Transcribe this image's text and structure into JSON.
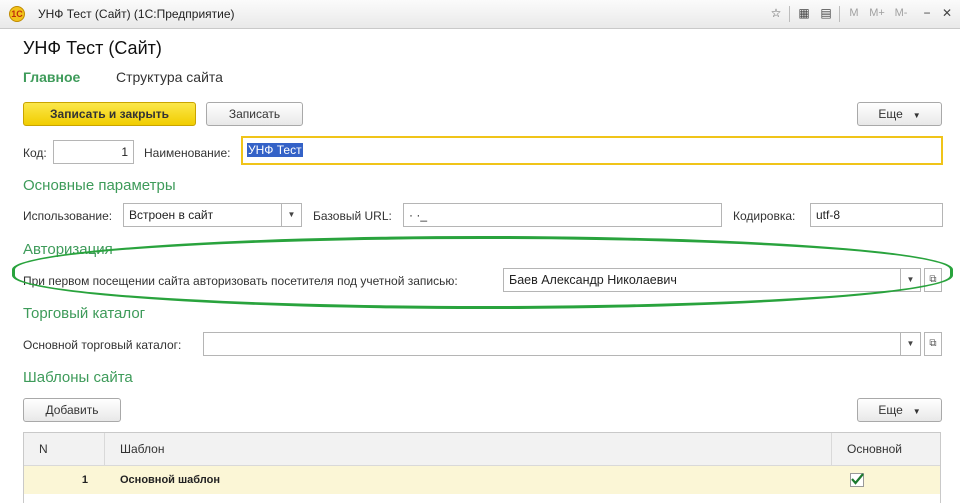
{
  "window": {
    "title": "УНФ Тест (Сайт)  (1С:Предприятие)",
    "logo_text": "1С",
    "toolbar_icons": [
      "star-icon",
      "calculator-icon",
      "calendar-icon"
    ],
    "memory_buttons": [
      "M",
      "M+",
      "M-"
    ]
  },
  "form": {
    "title": "УНФ Тест (Сайт)",
    "tabs": [
      {
        "label": "Главное",
        "active": true
      },
      {
        "label": "Структура сайта",
        "active": false
      }
    ],
    "actions": {
      "save_close": "Записать и закрыть",
      "save": "Записать",
      "more": "Еще"
    },
    "code": {
      "label": "Код:",
      "value": "1"
    },
    "name": {
      "label": "Наименование:",
      "value": "УНФ Тест"
    }
  },
  "basic": {
    "heading": "Основные параметры",
    "usage": {
      "label": "Использование:",
      "value": "Встроен в сайт"
    },
    "url": {
      "label": "Базовый URL:",
      "value": "·            ·_"
    },
    "encoding": {
      "label": "Кодировка:",
      "value": "utf-8"
    }
  },
  "auth": {
    "heading": "Авторизация",
    "label": "При первом посещении сайта авторизовать посетителя под учетной записью:",
    "value": "Баев Александр Николаевич"
  },
  "catalog": {
    "heading": "Торговый каталог",
    "label": "Основной торговый каталог:",
    "value": ""
  },
  "templates": {
    "heading": "Шаблоны сайта",
    "add": "Добавить",
    "more": "Еще",
    "columns": [
      "N",
      "Шаблон",
      "Основной"
    ],
    "rows": [
      {
        "n": "1",
        "template": "Основной шаблон",
        "main": true
      }
    ]
  },
  "colors": {
    "accent_green": "#3e9b5a",
    "primary_button": "#f1cd00",
    "highlight": "#29a33d"
  }
}
